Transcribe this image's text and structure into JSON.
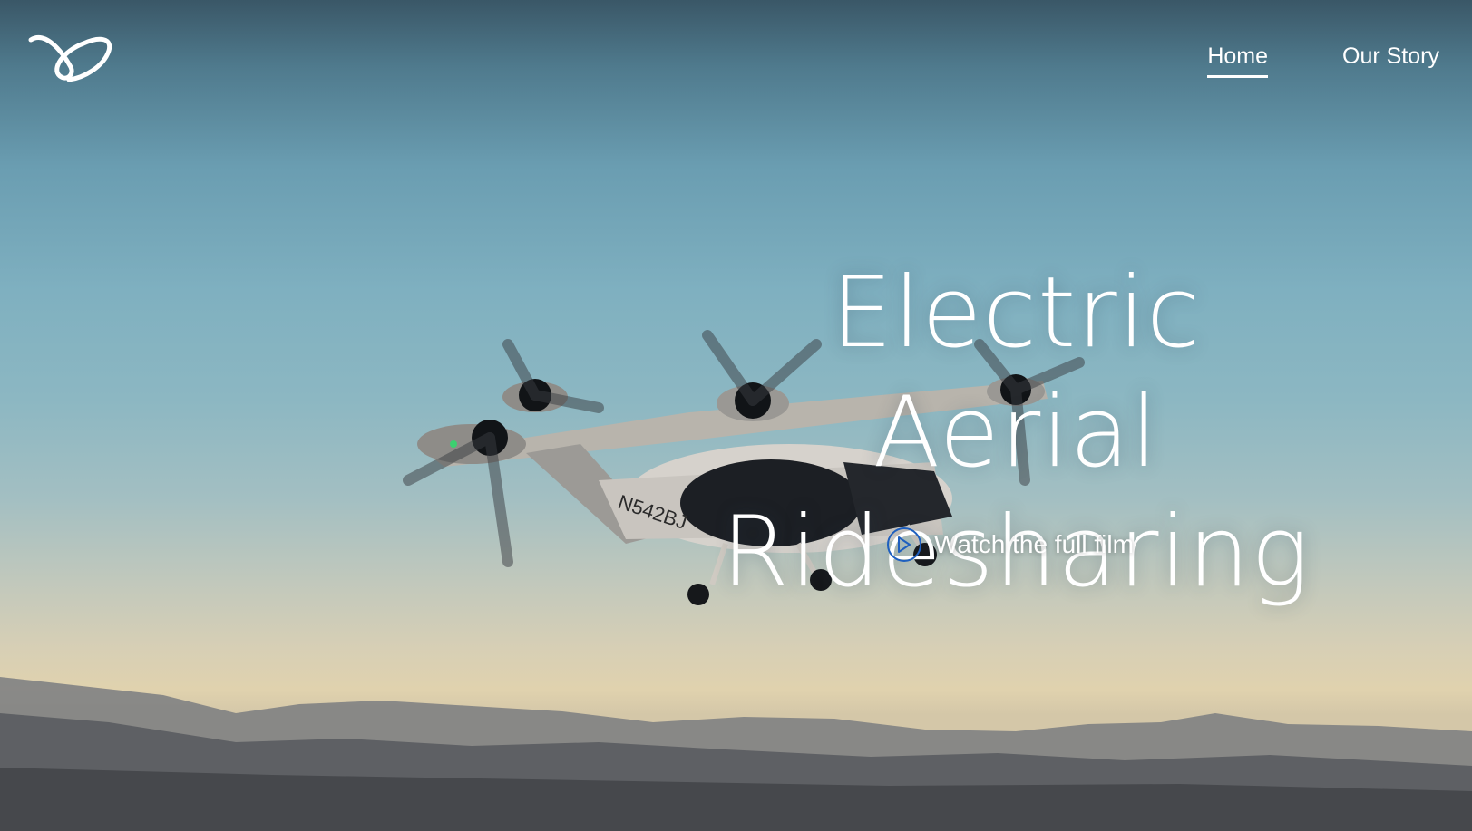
{
  "nav": {
    "logo_icon": "brand-swoosh-logo",
    "links": [
      {
        "label": "Home",
        "active": true
      },
      {
        "label": "Our Story",
        "active": false
      }
    ]
  },
  "hero": {
    "headline_line1": "Electric Aerial",
    "headline_line2": "Ridesharing",
    "cta_label": "Watch the full film",
    "cta_icon": "play-circle-icon",
    "accent_color": "#1e5fbf",
    "aircraft_tail_number": "N542BJ"
  }
}
